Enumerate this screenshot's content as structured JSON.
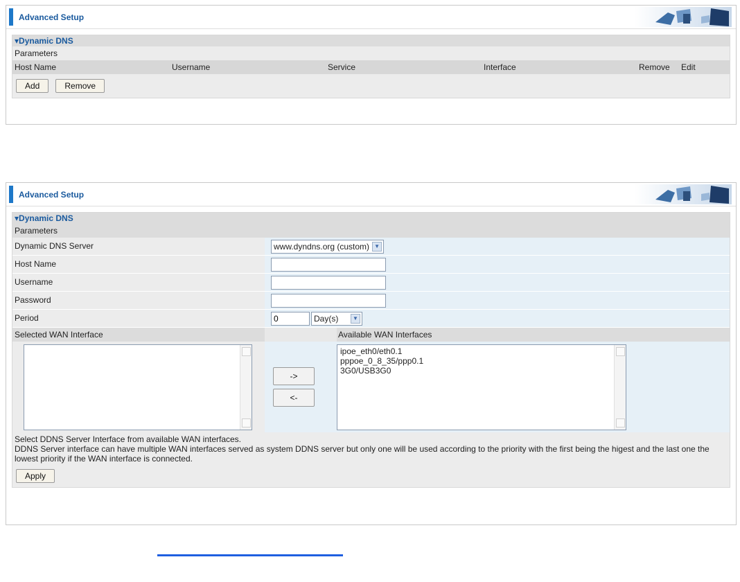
{
  "panel1": {
    "header_title": "Advanced Setup",
    "section_title": "Dynamic DNS",
    "params_label": "Parameters",
    "columns": [
      "Host Name",
      "Username",
      "Service",
      "Interface",
      "Remove",
      "Edit"
    ],
    "add_label": "Add",
    "remove_label": "Remove"
  },
  "panel2": {
    "header_title": "Advanced Setup",
    "section_title": "Dynamic DNS",
    "params_label": "Parameters",
    "server_label": "Dynamic DNS Server",
    "server_value": "www.dyndns.org (custom)",
    "hostname_label": "Host Name",
    "hostname_value": "",
    "username_label": "Username",
    "username_value": "",
    "password_label": "Password",
    "password_value": "",
    "period_label": "Period",
    "period_value": "0",
    "period_unit": "Day(s)",
    "selected_wan_label": "Selected WAN Interface",
    "available_wan_label": "Available WAN Interfaces",
    "available_interfaces": [
      "ipoe_eth0/eth0.1",
      "pppoe_0_8_35/ppp0.1",
      "3G0/USB3G0"
    ],
    "add_arrow": "->",
    "remove_arrow": "<-",
    "note_line1": "Select DDNS Server Interface from available WAN interfaces.",
    "note_line2": "DDNS Server interface can have multiple WAN interfaces served as system DDNS server but only one will be used according to the priority with the first being the higest and the last one the lowest priority if the WAN interface is connected.",
    "apply_label": "Apply"
  },
  "colors": {
    "accent": "#1e78c8",
    "title_text": "#1a5a9e",
    "field_bg": "#e6f0f7",
    "link": "#1e5fe0"
  }
}
